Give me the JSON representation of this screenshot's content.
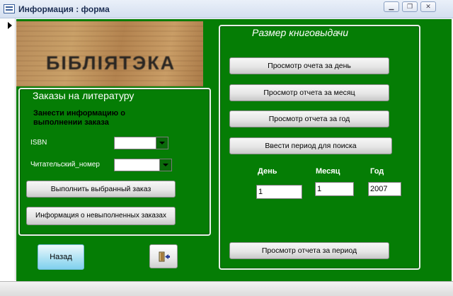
{
  "window": {
    "title": "Информация : форма",
    "controls": {
      "minimize": "▁",
      "restore": "❐",
      "close": "✕"
    }
  },
  "colors": {
    "form_bg": "#057d05",
    "frame": "#e6f0e6",
    "back_button": "#7fd0ee"
  },
  "photo": {
    "text": "БІБЛІЯТЭКА"
  },
  "orders": {
    "title": "Заказы на литературу",
    "instruction": "Занести информацию о выполнении заказа",
    "isbn_label": "ISBN",
    "isbn_value": "",
    "reader_label": "Читательский_номер",
    "reader_value": "",
    "execute_button": "Выполнить выбранный заказ",
    "pending_button": "Информация о невыполненных заказах"
  },
  "report": {
    "title": "Размер книговыдачи",
    "day_button": "Просмотр очета за день",
    "month_button": "Просмотр отчета за месяц",
    "year_button": "Просмотр отчета за год",
    "period_input_button": "Ввести период для поиска",
    "day_label": "День",
    "month_label": "Месяц",
    "year_label": "Год",
    "day_value": "1",
    "month_value": "1",
    "year_value": "2007",
    "period_button": "Просмотр отчета за период"
  },
  "footer": {
    "back_button": "Назад",
    "exit_icon": "exit-door-icon"
  }
}
